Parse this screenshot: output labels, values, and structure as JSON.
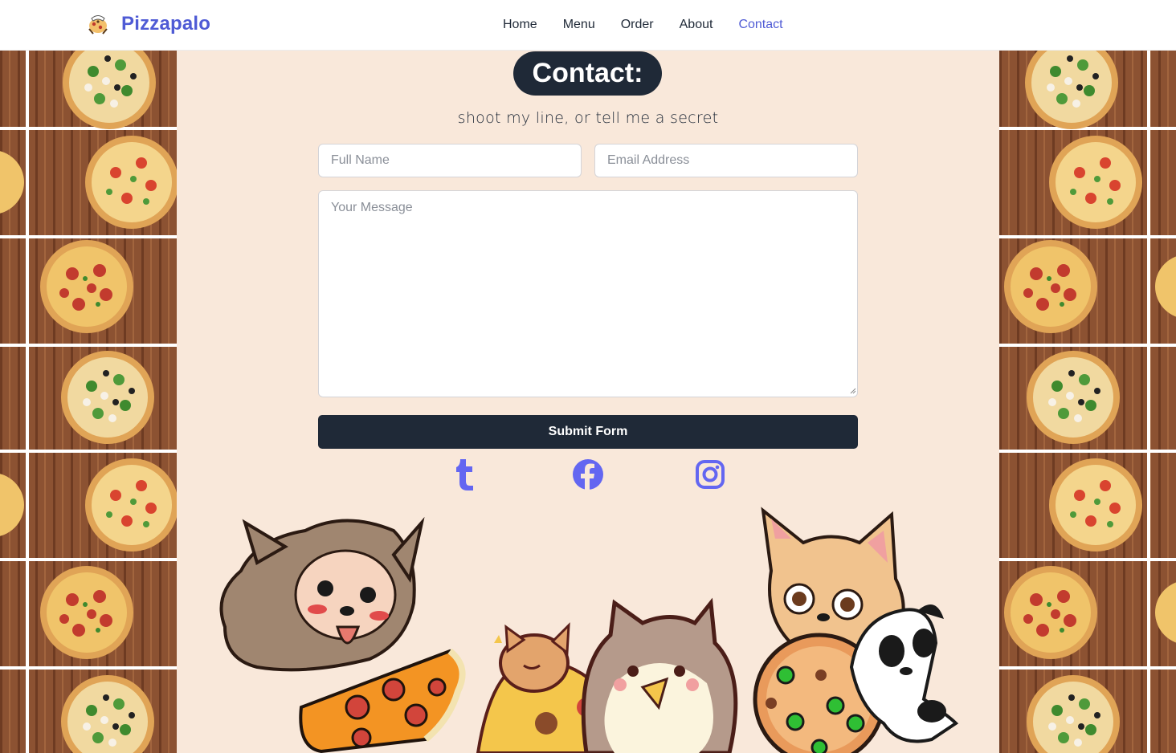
{
  "nav": {
    "brand": "Pizzapalo",
    "links": [
      {
        "label": "Home",
        "active": false
      },
      {
        "label": "Menu",
        "active": false
      },
      {
        "label": "Order",
        "active": false
      },
      {
        "label": "About",
        "active": false
      },
      {
        "label": "Contact",
        "active": true
      }
    ]
  },
  "contact": {
    "heading": "Contact:",
    "subtitle": "shoot my line, or tell me a secret",
    "full_name_placeholder": "Full Name",
    "email_placeholder": "Email Address",
    "message_placeholder": "Your Message",
    "submit_label": "Submit Form"
  },
  "social": [
    "tumblr-icon",
    "facebook-icon",
    "instagram-icon"
  ],
  "colors": {
    "accent": "#4f5bd5",
    "dark": "#1f2937",
    "background": "#f9e8da",
    "social_icon": "#6366f1"
  }
}
